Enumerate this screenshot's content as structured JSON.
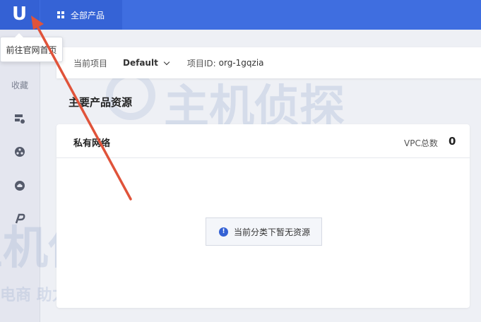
{
  "topbar": {
    "logo_letter": "U",
    "all_products_label": "全部产品"
  },
  "tooltip": {
    "text": "前往官网首页"
  },
  "sidebar": {
    "favorites_label": "收藏",
    "icons": [
      "server-icon",
      "network-icon",
      "cloud-icon",
      "route-icon"
    ]
  },
  "project_bar": {
    "current_project_label": "当前项目",
    "current_project_value": "Default",
    "project_id_label": "项目ID:",
    "project_id_value": "org-1gqzia"
  },
  "main": {
    "section_title": "主要产品资源",
    "card": {
      "title": "私有网络",
      "vpc_label": "VPC总数",
      "vpc_count": "0",
      "empty_message": "当前分类下暂无资源"
    }
  },
  "watermark": {
    "brand": "主机侦探",
    "slogan": "服务跨境电商 助力中企出海"
  },
  "annotation": {
    "arrow_color": "#e0533a"
  }
}
